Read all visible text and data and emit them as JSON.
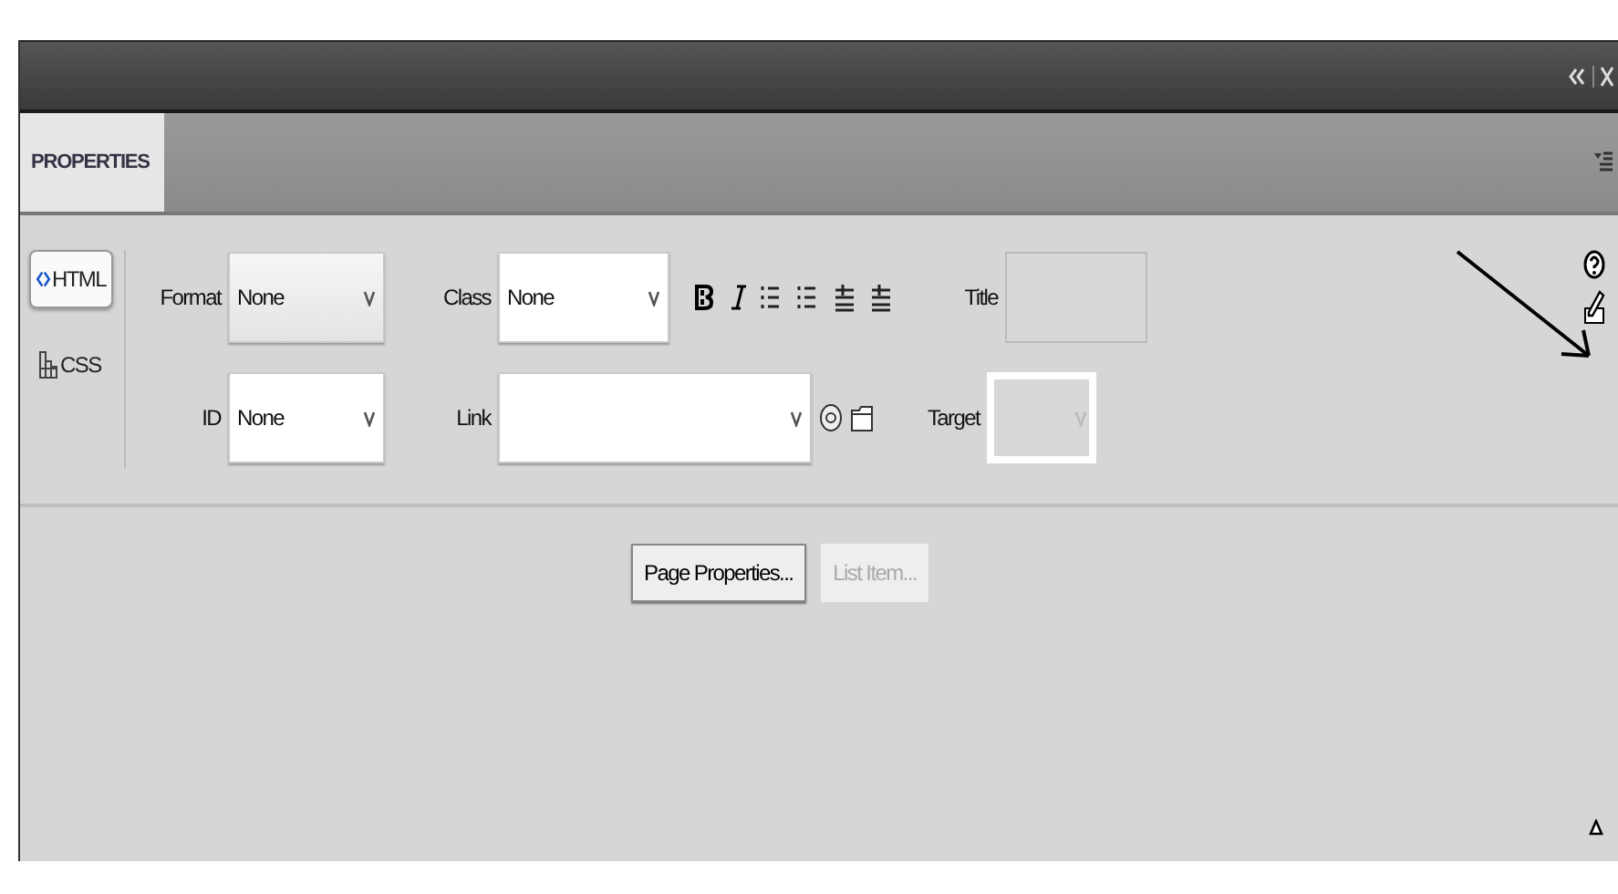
{
  "panel": {
    "tab": "PROPERTIES"
  },
  "modes": [
    {
      "label": "HTML",
      "kind": "html",
      "selected": true
    },
    {
      "label": "CSS",
      "kind": "css",
      "selected": false
    }
  ],
  "row_1": [
    {
      "label": "Format",
      "kind": "select",
      "value": "None",
      "disabled": false,
      "shaded": true
    },
    {
      "label": "Class",
      "kind": "select",
      "value": "None",
      "disabled": false,
      "shaded": false
    },
    {
      "kind": "format-tools"
    },
    {
      "label": "Title",
      "kind": "input",
      "disabled": true,
      "shaded": false
    }
  ],
  "row_2": [
    {
      "label": "ID",
      "kind": "select",
      "value": "None",
      "disabled": false,
      "shaded": false
    },
    {
      "label": "Link",
      "kind": "link",
      "disabled": false,
      "shaded": false
    },
    {
      "label": "Target",
      "kind": "select",
      "disabled": true,
      "shaded": false
    }
  ],
  "buttons": [
    {
      "label": "Page Properties...",
      "disabled": false
    },
    {
      "label": "List Item...",
      "disabled": true
    }
  ]
}
